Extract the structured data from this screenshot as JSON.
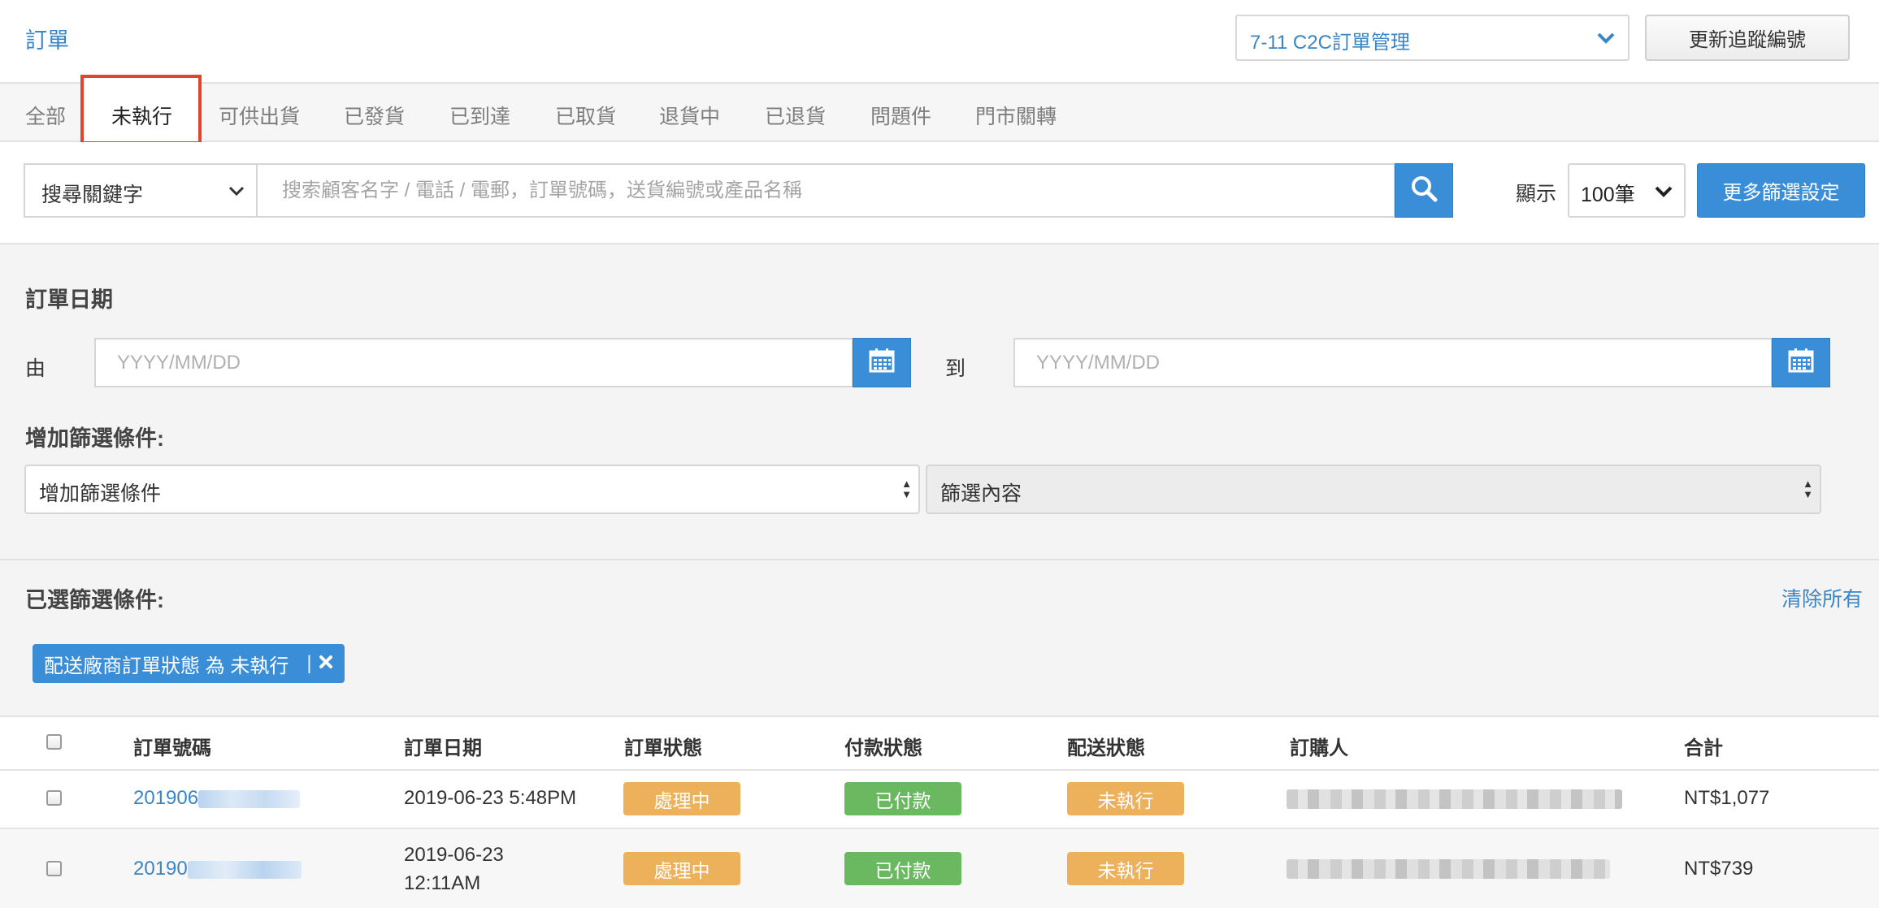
{
  "header": {
    "title": "訂單",
    "store_select": "7-11 C2C訂單管理",
    "update_button": "更新追蹤編號"
  },
  "tabs": [
    "全部",
    "未執行",
    "可供出貨",
    "已發貨",
    "已到達",
    "已取貨",
    "退貨中",
    "已退貨",
    "問題件",
    "門市關轉"
  ],
  "active_tab_index": 1,
  "search": {
    "keyword_select": "搜尋關鍵字",
    "placeholder": "搜索顧客名字 / 電話 / 電郵，訂單號碼，送貨編號或產品名稱",
    "show_label": "顯示",
    "count_select": "100筆",
    "more_filter_button": "更多篩選設定"
  },
  "filters": {
    "order_date_title": "訂單日期",
    "from_label": "由",
    "to_label": "到",
    "date_placeholder": "YYYY/MM/DD",
    "add_condition_title": "增加篩選條件:",
    "add_condition_select": "增加篩選條件",
    "filter_content_select": "篩選內容",
    "selected_title": "已選篩選條件:",
    "clear_all": "清除所有",
    "chip_label": "配送廠商訂單狀態 為 未執行",
    "chip_separator": "|"
  },
  "table": {
    "headers": [
      "訂單號碼",
      "訂單日期",
      "訂單狀態",
      "付款狀態",
      "配送狀態",
      "訂購人",
      "合計"
    ],
    "rows": [
      {
        "order_no_visible": "201906",
        "date": "2019-06-23 5:48PM",
        "order_status": "處理中",
        "payment_status": "已付款",
        "delivery_status": "未執行",
        "total": "NT$1,077"
      },
      {
        "order_no_visible": "20190",
        "date_line1": "2019-06-23",
        "date_line2": "12:11AM",
        "order_status": "處理中",
        "payment_status": "已付款",
        "delivery_status": "未執行",
        "total": "NT$739"
      }
    ]
  },
  "colors": {
    "primary": "#3a8ed8",
    "link": "#3a85c6",
    "active_tab_border": "#e0462b",
    "badge_orange": "#edb05b",
    "badge_green": "#6ab85f"
  }
}
